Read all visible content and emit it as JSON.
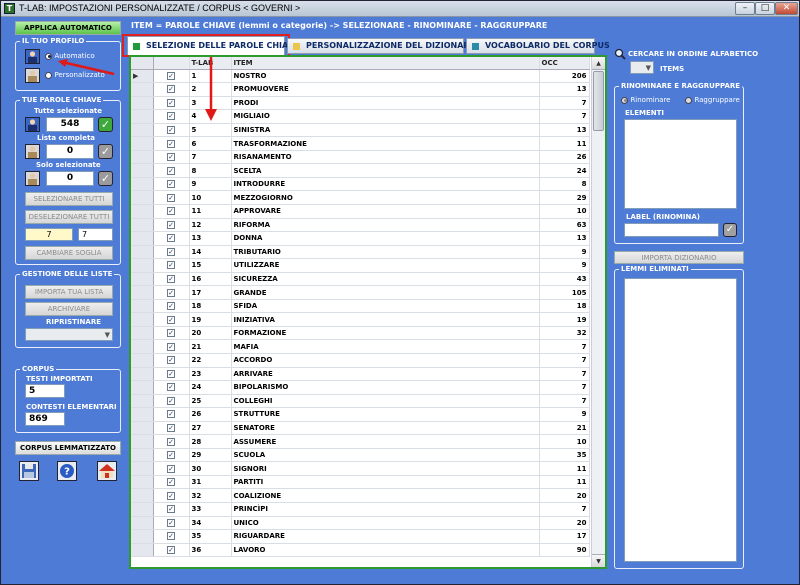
{
  "window": {
    "title": "T-LAB: IMPOSTAZIONI PERSONALIZZATE  /  CORPUS < GOVERNI >",
    "app_icon": "T",
    "min": "–",
    "max": "□",
    "close": "✕"
  },
  "left": {
    "apply_button": "APPLICA AUTOMATICO",
    "profile": {
      "title": "IL TUO PROFILO",
      "automatic": "Automatico",
      "personalized": "Personalizzato"
    },
    "keywords": {
      "title": "TUE PAROLE CHIAVE",
      "selected_label": "Tutte selezionate",
      "selected_value": "548",
      "full_list_label": "Lista completa",
      "full_list_value": "0",
      "only_selected_label": "Solo selezionate",
      "only_selected_value": "0",
      "select_all": "SELEZIONARE TUTTI",
      "deselect_all": "DESELEZIONARE TUTTI",
      "threshold_value": "7",
      "threshold_spin": "7",
      "change_threshold": "CAMBIARE SOGLIA"
    },
    "lists": {
      "title": "GESTIONE DELLE LISTE",
      "import": "IMPORTA TUA LISTA",
      "archive": "ARCHIVIARE",
      "restore_label": "RIPRISTINARE"
    },
    "corpus": {
      "title": "CORPUS",
      "texts_label": "TESTI IMPORTATI",
      "texts_value": "5",
      "contexts_label": "CONTESTI ELEMENTARI",
      "contexts_value": "869"
    },
    "lemmatized_button": "CORPUS LEMMATIZZATO"
  },
  "header": {
    "breadcrumb": "ITEM = PAROLE CHIAVE (lemmi o categorie) -> SELEZIONARE - RINOMINARE - RAGGRUPPARE"
  },
  "tabs": [
    {
      "label": "SELEZIONE DELLE PAROLE CHIAVE",
      "color": "#1e9a3a"
    },
    {
      "label": "PERSONALIZZAZIONE DEL DIZIONARIO",
      "color": "#e8c84a"
    },
    {
      "label": "VOCABOLARIO DEL CORPUS",
      "color": "#2a8aaa"
    }
  ],
  "table": {
    "headers": [
      "T-LAB",
      "ITEM",
      "OCC"
    ],
    "rows": [
      [
        "1",
        "NOSTRO",
        "206"
      ],
      [
        "2",
        "PROMUOVERE",
        "13"
      ],
      [
        "3",
        "PRODI",
        "7"
      ],
      [
        "4",
        "MIGLIAIO",
        "7"
      ],
      [
        "5",
        "SINISTRA",
        "13"
      ],
      [
        "6",
        "TRASFORMAZIONE",
        "11"
      ],
      [
        "7",
        "RISANAMENTO",
        "26"
      ],
      [
        "8",
        "SCELTA",
        "24"
      ],
      [
        "9",
        "INTRODURRE",
        "8"
      ],
      [
        "10",
        "MEZZOGIORNO",
        "29"
      ],
      [
        "11",
        "APPROVARE",
        "10"
      ],
      [
        "12",
        "RIFORMA",
        "63"
      ],
      [
        "13",
        "DONNA",
        "13"
      ],
      [
        "14",
        "TRIBUTARIO",
        "9"
      ],
      [
        "15",
        "UTILIZZARE",
        "9"
      ],
      [
        "16",
        "SICUREZZA",
        "43"
      ],
      [
        "17",
        "GRANDE",
        "105"
      ],
      [
        "18",
        "SFIDA",
        "18"
      ],
      [
        "19",
        "INIZIATIVA",
        "19"
      ],
      [
        "20",
        "FORMAZIONE",
        "32"
      ],
      [
        "21",
        "MAFIA",
        "7"
      ],
      [
        "22",
        "ACCORDO",
        "7"
      ],
      [
        "23",
        "ARRIVARE",
        "7"
      ],
      [
        "24",
        "BIPOLARISMO",
        "7"
      ],
      [
        "25",
        "COLLEGHI",
        "7"
      ],
      [
        "26",
        "STRUTTURE",
        "9"
      ],
      [
        "27",
        "SENATORE",
        "21"
      ],
      [
        "28",
        "ASSUMERE",
        "10"
      ],
      [
        "29",
        "SCUOLA",
        "35"
      ],
      [
        "30",
        "SIGNORI",
        "11"
      ],
      [
        "31",
        "PARTITI",
        "11"
      ],
      [
        "32",
        "COALIZIONE",
        "20"
      ],
      [
        "33",
        "PRINCÌPI",
        "7"
      ],
      [
        "34",
        "UNICO",
        "20"
      ],
      [
        "35",
        "RIGUARDARE",
        "17"
      ],
      [
        "36",
        "LAVORO",
        "90"
      ]
    ]
  },
  "right": {
    "search_label": "CERCARE IN ORDINE ALFABETICO",
    "items_label": "ITEMS",
    "rename_group": {
      "title": "RINOMINARE E RAGGRUPPARE",
      "rename": "Rinominare",
      "group": "Raggruppare",
      "elements_label": "ELEMENTI",
      "label_label": "LABEL (RINOMINA)"
    },
    "import_dictionary": "IMPORTA DIZIONARIO",
    "removed_title": "LEMMI ELIMINATI"
  }
}
